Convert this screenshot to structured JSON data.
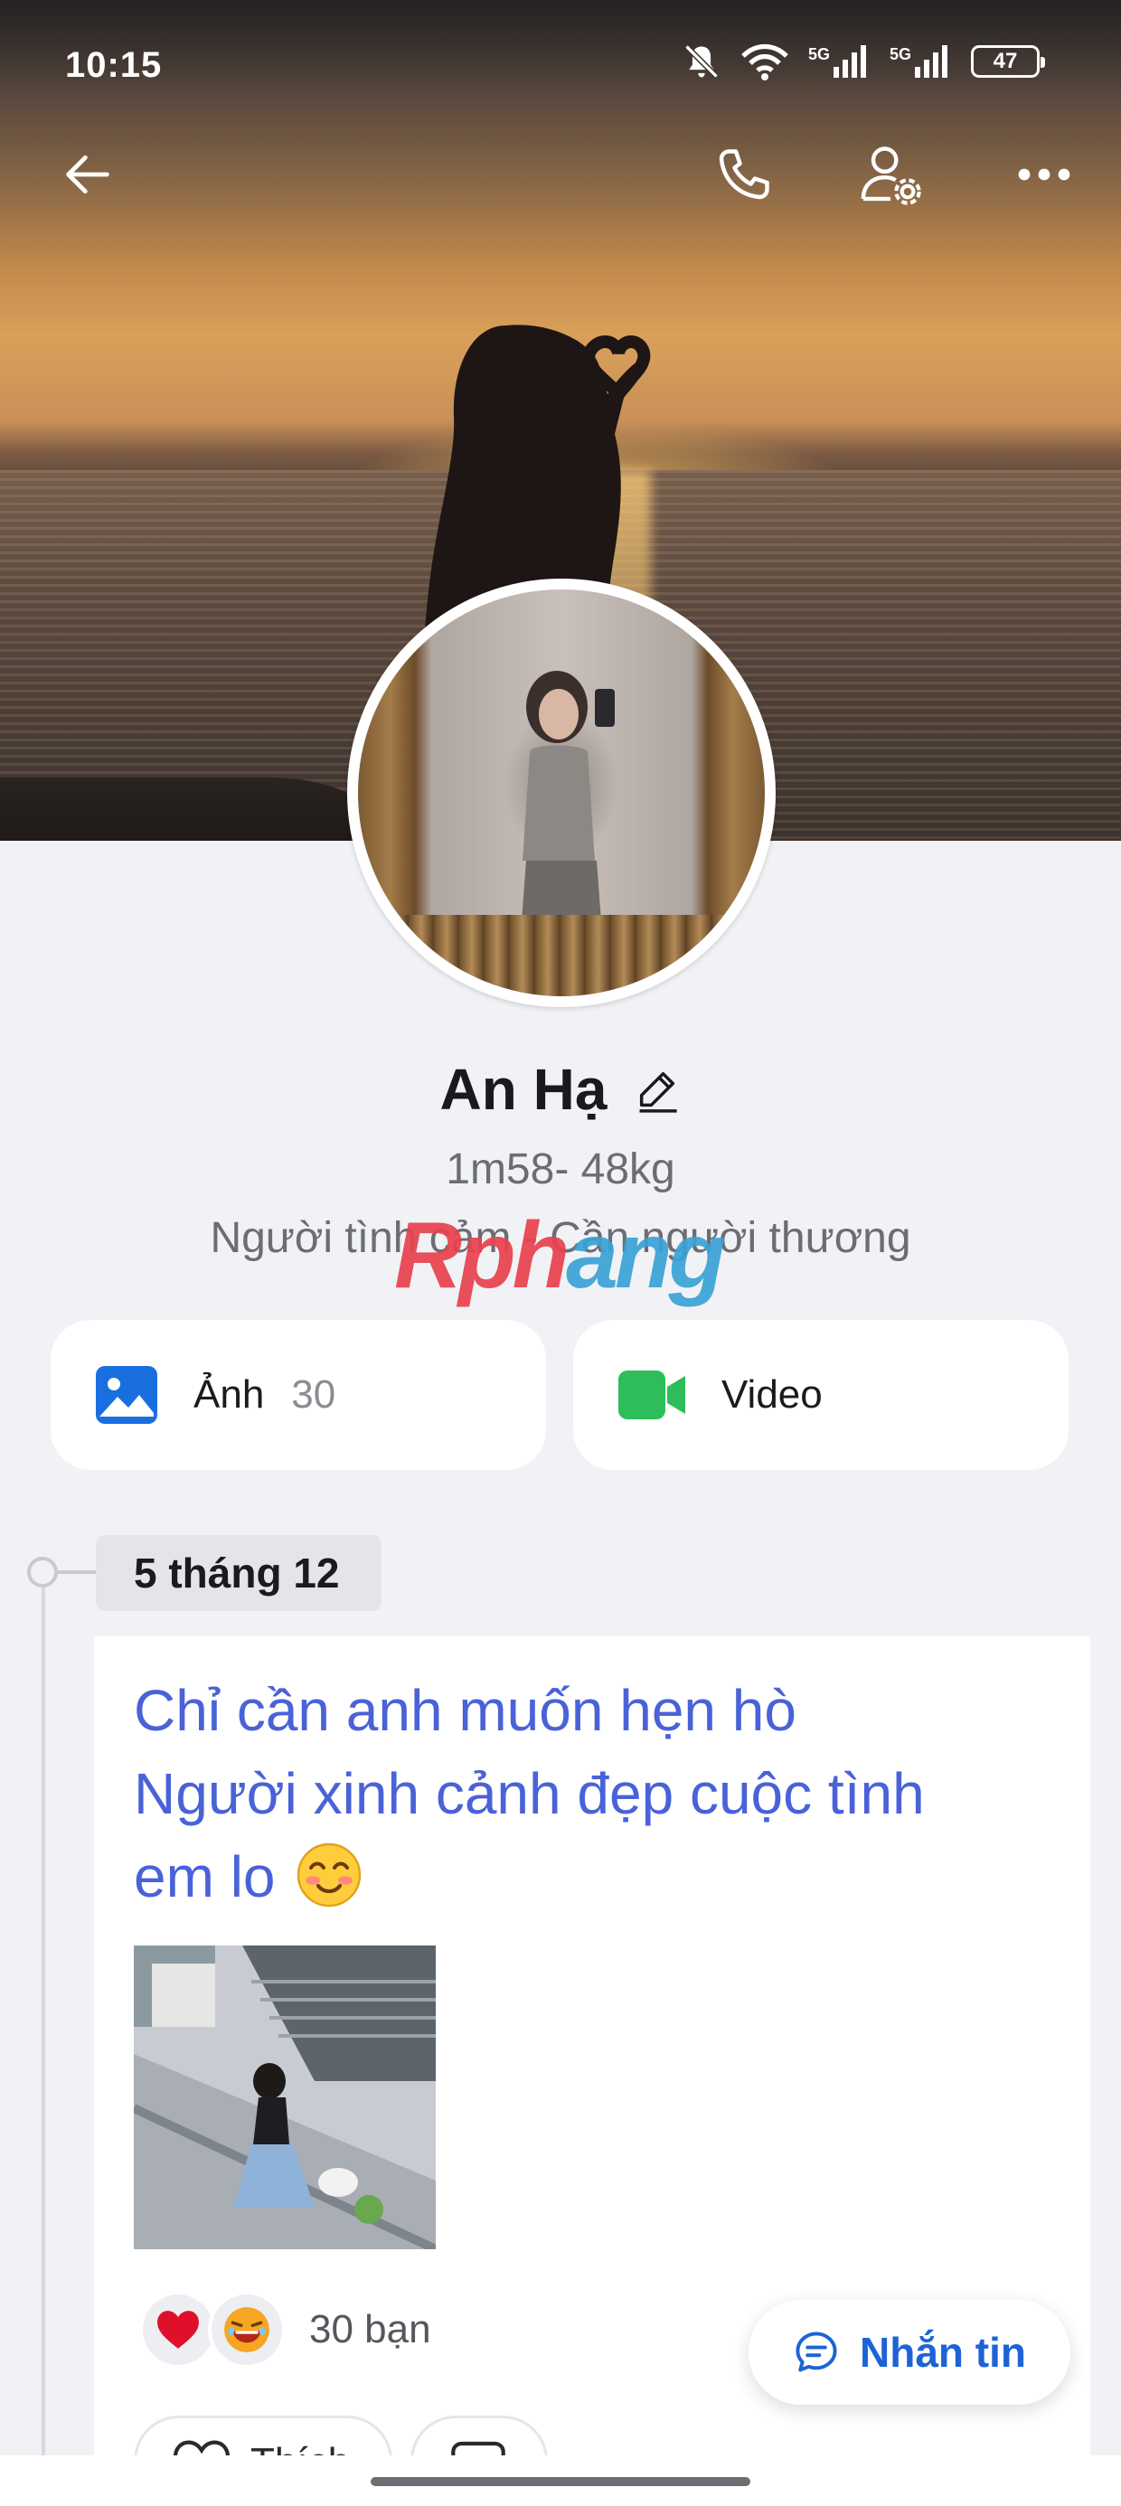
{
  "status_bar": {
    "time": "10:15",
    "network_1": "5G",
    "network_2": "5G",
    "battery": "47"
  },
  "profile": {
    "name": "An Hạ",
    "bio_line_1": "1m58- 48kg",
    "bio_line_2": "Người tình cảm - Cần người thương"
  },
  "watermark": {
    "part_1": "Rph",
    "part_2": "ang"
  },
  "media": {
    "photos_label": "Ảnh",
    "photos_count": "30",
    "video_label": "Video"
  },
  "timeline": {
    "date": "5 tháng 12"
  },
  "post": {
    "line_1": "Chỉ cần anh muốn hẹn hò",
    "line_2": "Người xinh cảnh đẹp cuộc tình",
    "line_3": "em lo",
    "reaction_count": "30 bạn",
    "like_label": "Thích"
  },
  "chat_button": {
    "label": "Nhắn tin"
  },
  "colors": {
    "post_text": "#4a62d8",
    "chat_accent": "#1d63d6",
    "photo_icon": "#1a6fe0",
    "video_icon": "#2dbd5a",
    "background": "#f1f2f6"
  },
  "icons": [
    "back-arrow-icon",
    "phone-icon",
    "person-settings-icon",
    "more-icon",
    "edit-icon",
    "photo-icon",
    "video-camera-icon",
    "heart-icon",
    "laugh-icon",
    "comment-icon",
    "chat-icon"
  ]
}
